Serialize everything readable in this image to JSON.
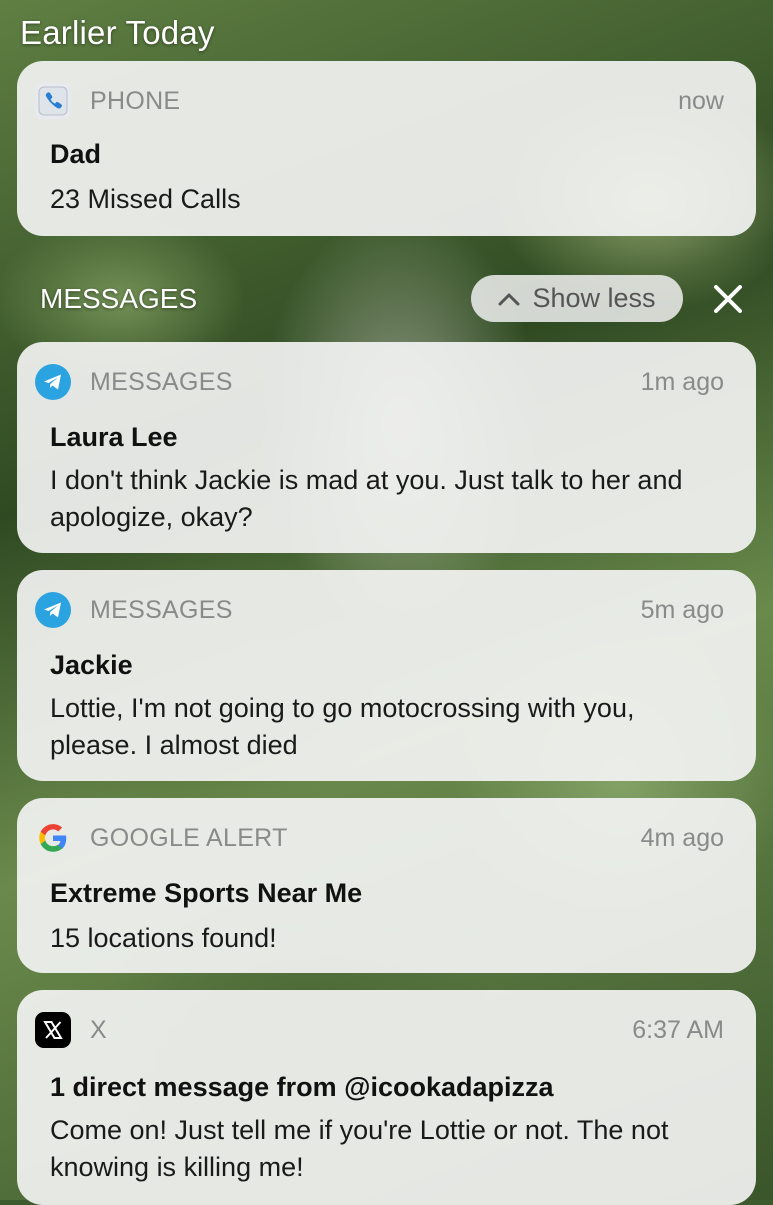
{
  "header": {
    "title": "Earlier Today"
  },
  "group": {
    "label": "MESSAGES",
    "show_less_label": "Show less"
  },
  "notifications": [
    {
      "app": "PHONE",
      "icon": "phone-icon",
      "time": "now",
      "title": "Dad",
      "body": "23 Missed Calls"
    },
    {
      "app": "MESSAGES",
      "icon": "telegram-icon",
      "time": "1m ago",
      "title": "Laura Lee",
      "body": "I don't think Jackie is mad at you. Just talk to her and apologize, okay?"
    },
    {
      "app": "MESSAGES",
      "icon": "telegram-icon",
      "time": "5m ago",
      "title": "Jackie",
      "body": "Lottie, I'm not going to go motocrossing with you, please. I almost died"
    },
    {
      "app": "GOOGLE ALERT",
      "icon": "google-icon",
      "time": "4m ago",
      "title": "Extreme Sports Near Me",
      "body": "15 locations found!"
    },
    {
      "app": "X",
      "icon": "x-logo-icon",
      "time": "6:37 AM",
      "title": "1 direct message from @icookadapizza",
      "body": "Come on! Just tell me if you're Lottie or not. The not knowing is killing me!"
    }
  ],
  "colors": {
    "telegram": "#2AA3E0",
    "x_bg": "#000000",
    "card_bg": "#F6F6F6"
  }
}
